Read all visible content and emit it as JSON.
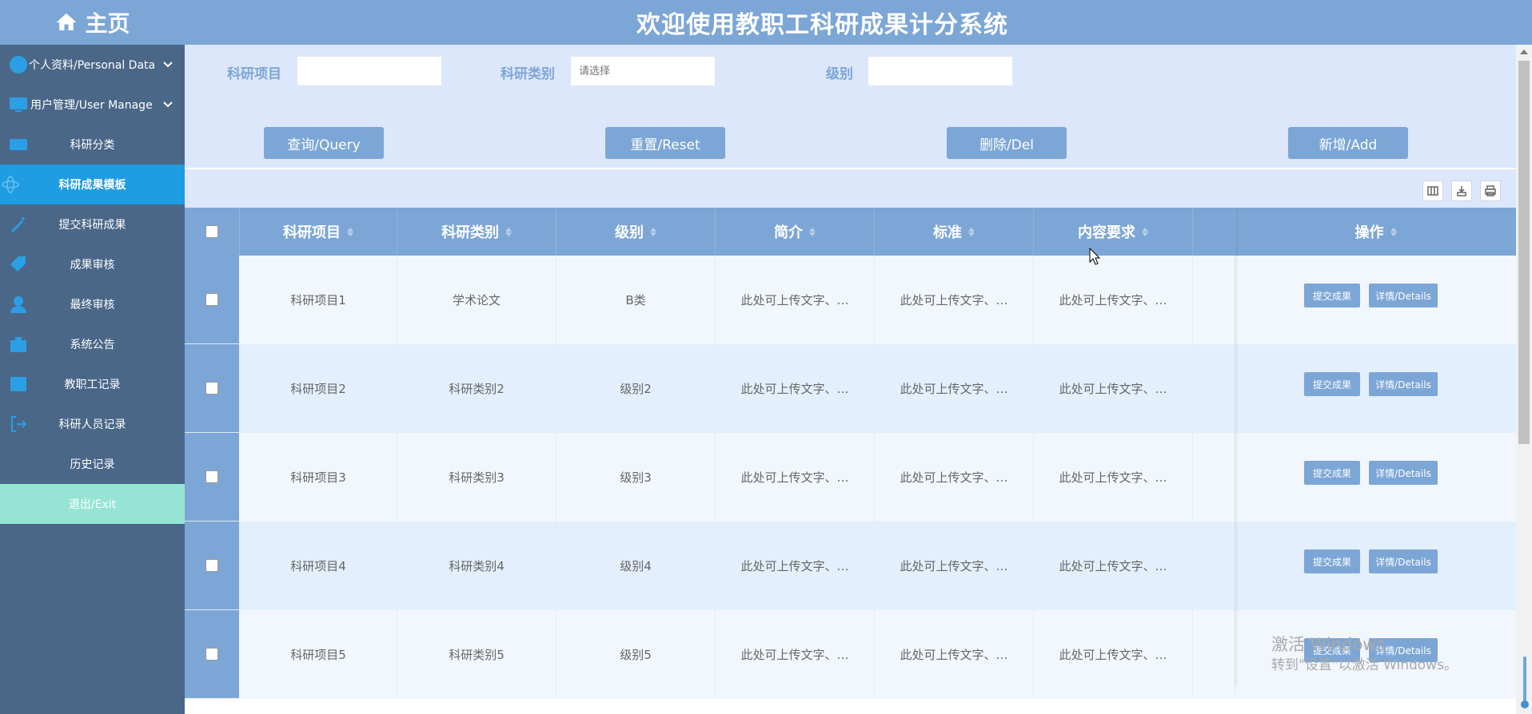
{
  "sidebar": {
    "home_label": "主页",
    "items": [
      {
        "label": "个人资料/Personal Data",
        "icon": "user-circle-icon",
        "has_sub": true
      },
      {
        "label": "用户管理/User Manage",
        "icon": "monitor-icon",
        "has_sub": true
      },
      {
        "label": "科研分类",
        "icon": "id-card-icon"
      },
      {
        "label": "科研成果模板",
        "icon": "atom-icon",
        "active": true
      },
      {
        "label": "提交科研成果",
        "icon": "magic-wand-icon"
      },
      {
        "label": "成果审核",
        "icon": "tag-icon"
      },
      {
        "label": "最终审核",
        "icon": "user-badge-icon"
      },
      {
        "label": "系统公告",
        "icon": "briefcase-icon"
      },
      {
        "label": "教职工记录",
        "icon": "book-icon"
      },
      {
        "label": "科研人员记录",
        "icon": "sign-out-icon"
      },
      {
        "label": "历史记录",
        "icon": ""
      },
      {
        "label": "退出/Exit",
        "icon": ""
      }
    ]
  },
  "header": {
    "title": "欢迎使用教职工科研成果计分系统"
  },
  "filters": {
    "project_label": "科研项目",
    "project_value": "",
    "category_label": "科研类别",
    "category_placeholder": "请选择",
    "level_label": "级别",
    "level_value": ""
  },
  "buttons": {
    "query": "查询/Query",
    "reset": "重置/Reset",
    "delete": "删除/Del",
    "add": "新增/Add"
  },
  "toolbar_icons": [
    "columns-icon",
    "export-icon",
    "print-icon"
  ],
  "table": {
    "columns": [
      "科研项目",
      "科研类别",
      "级别",
      "简介",
      "标准",
      "内容要求",
      "",
      "操作"
    ],
    "rows": [
      {
        "project": "科研项目1",
        "category": "学术论文",
        "level": "B类",
        "intro": "此处可上传文字、…",
        "standard": "此处可上传文字、…",
        "requirement": "此处可上传文字、…"
      },
      {
        "project": "科研项目2",
        "category": "科研类别2",
        "level": "级别2",
        "intro": "此处可上传文字、…",
        "standard": "此处可上传文字、…",
        "requirement": "此处可上传文字、…"
      },
      {
        "project": "科研项目3",
        "category": "科研类别3",
        "level": "级别3",
        "intro": "此处可上传文字、…",
        "standard": "此处可上传文字、…",
        "requirement": "此处可上传文字、…"
      },
      {
        "project": "科研项目4",
        "category": "科研类别4",
        "level": "级别4",
        "intro": "此处可上传文字、…",
        "standard": "此处可上传文字、…",
        "requirement": "此处可上传文字、…"
      },
      {
        "project": "科研项目5",
        "category": "科研类别5",
        "level": "级别5",
        "intro": "此处可上传文字、…",
        "standard": "此处可上传文字、…",
        "requirement": "此处可上传文字、…"
      }
    ],
    "action_submit": "提交成果",
    "action_details": "详情/Details"
  },
  "watermark": {
    "line1": "激活 Windows",
    "line2": "转到\"设置\"以激活 Windows。"
  },
  "colors": {
    "primary": "#7ca6d6",
    "sidebar_bg": "#4a6788",
    "active": "#1e9de3",
    "exit": "#96e5d4",
    "filter_bg": "#dde7fb"
  }
}
